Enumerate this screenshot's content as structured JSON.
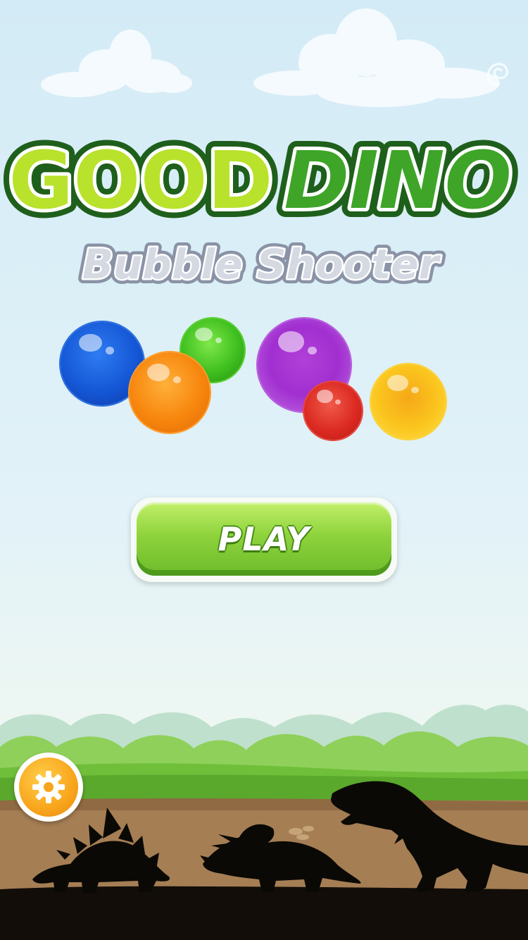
{
  "title": {
    "word1": "GOOD",
    "word2": "DINO",
    "subtitle": "Bubble Shooter"
  },
  "menu": {
    "play_label": "PLAY",
    "settings_icon": "gear-icon"
  },
  "bubbles": [
    {
      "color": "blue"
    },
    {
      "color": "orange"
    },
    {
      "color": "green"
    },
    {
      "color": "purple"
    },
    {
      "color": "red"
    },
    {
      "color": "yellow"
    }
  ],
  "colors": {
    "title_light_green": "#b9e22c",
    "title_dark_green": "#3ea528",
    "title_outline": "#1f5f1c",
    "play_green": "#8ed33c",
    "settings_orange": "#f8a51c"
  },
  "decor": {
    "top_right_icon": "swirl-icon",
    "silhouettes": [
      "stegosaurus-silhouette",
      "triceratops-silhouette",
      "t-rex-silhouette"
    ]
  }
}
